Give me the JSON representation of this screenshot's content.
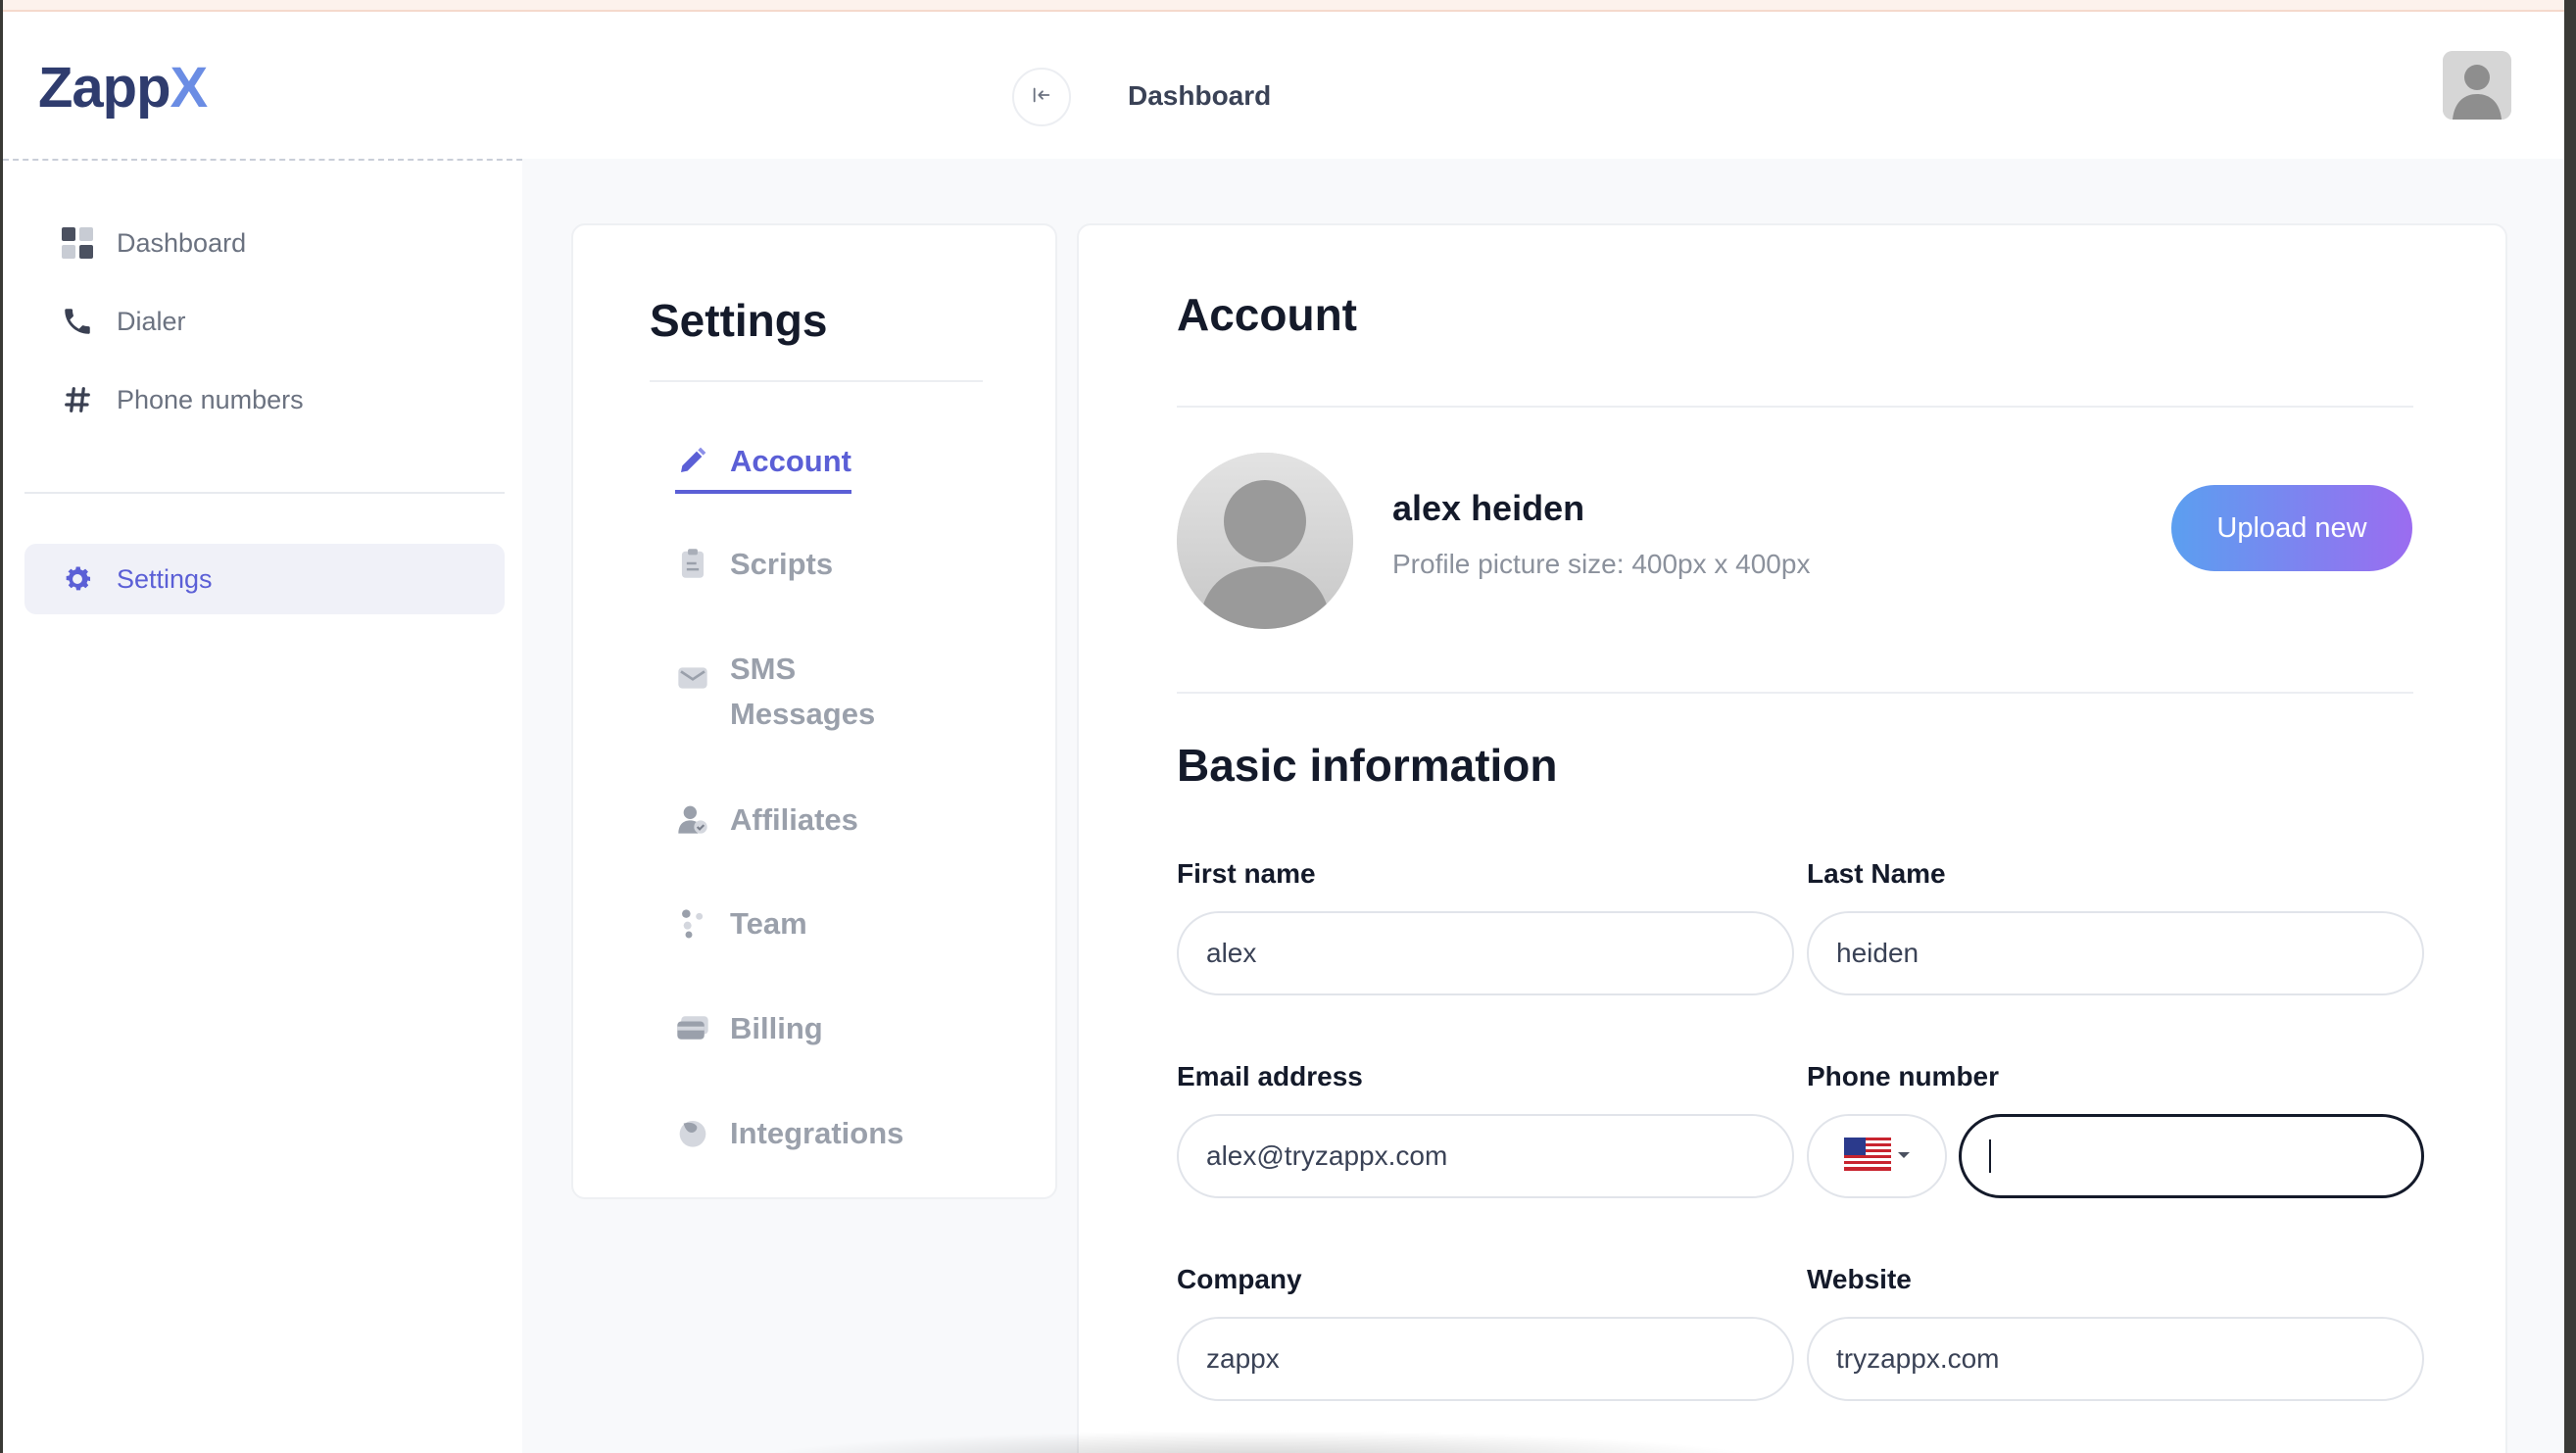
{
  "brand": {
    "part1": "Zapp",
    "part2": "X"
  },
  "sidebar": {
    "items": [
      {
        "label": "Dashboard",
        "icon": "dashboard-grid-icon"
      },
      {
        "label": "Dialer",
        "icon": "phone-icon"
      },
      {
        "label": "Phone numbers",
        "icon": "hash-icon"
      }
    ],
    "settings": {
      "label": "Settings",
      "icon": "gear-icon",
      "active": true
    }
  },
  "header": {
    "title": "Dashboard",
    "collapse_icon": "collapse-left-icon"
  },
  "settings_menu": {
    "title": "Settings",
    "items": [
      {
        "label": "Account",
        "icon": "pencil-icon",
        "active": true
      },
      {
        "label": "Scripts",
        "icon": "clipboard-icon"
      },
      {
        "label": "SMS Messages",
        "icon": "envelope-icon"
      },
      {
        "label": "Affiliates",
        "icon": "user-check-icon"
      },
      {
        "label": "Team",
        "icon": "team-icon"
      },
      {
        "label": "Billing",
        "icon": "credit-card-icon"
      },
      {
        "label": "Integrations",
        "icon": "puzzle-icon"
      }
    ]
  },
  "account": {
    "title": "Account",
    "profile": {
      "name": "alex heiden",
      "hint": "Profile picture size: 400px x 400px",
      "upload_label": "Upload new"
    },
    "basic": {
      "title": "Basic information",
      "first_name": {
        "label": "First name",
        "value": "alex"
      },
      "last_name": {
        "label": "Last Name",
        "value": "heiden"
      },
      "email": {
        "label": "Email address",
        "value": "alex@tryzappx.com"
      },
      "phone": {
        "label": "Phone number",
        "value": "",
        "country": "US"
      },
      "company": {
        "label": "Company",
        "value": "zappx"
      },
      "website": {
        "label": "Website",
        "value": "tryzappx.com"
      }
    }
  },
  "colors": {
    "accent": "#5b5fd6",
    "upload_gradient_start": "#5b9ff0",
    "upload_gradient_end": "#9b6cf0"
  }
}
